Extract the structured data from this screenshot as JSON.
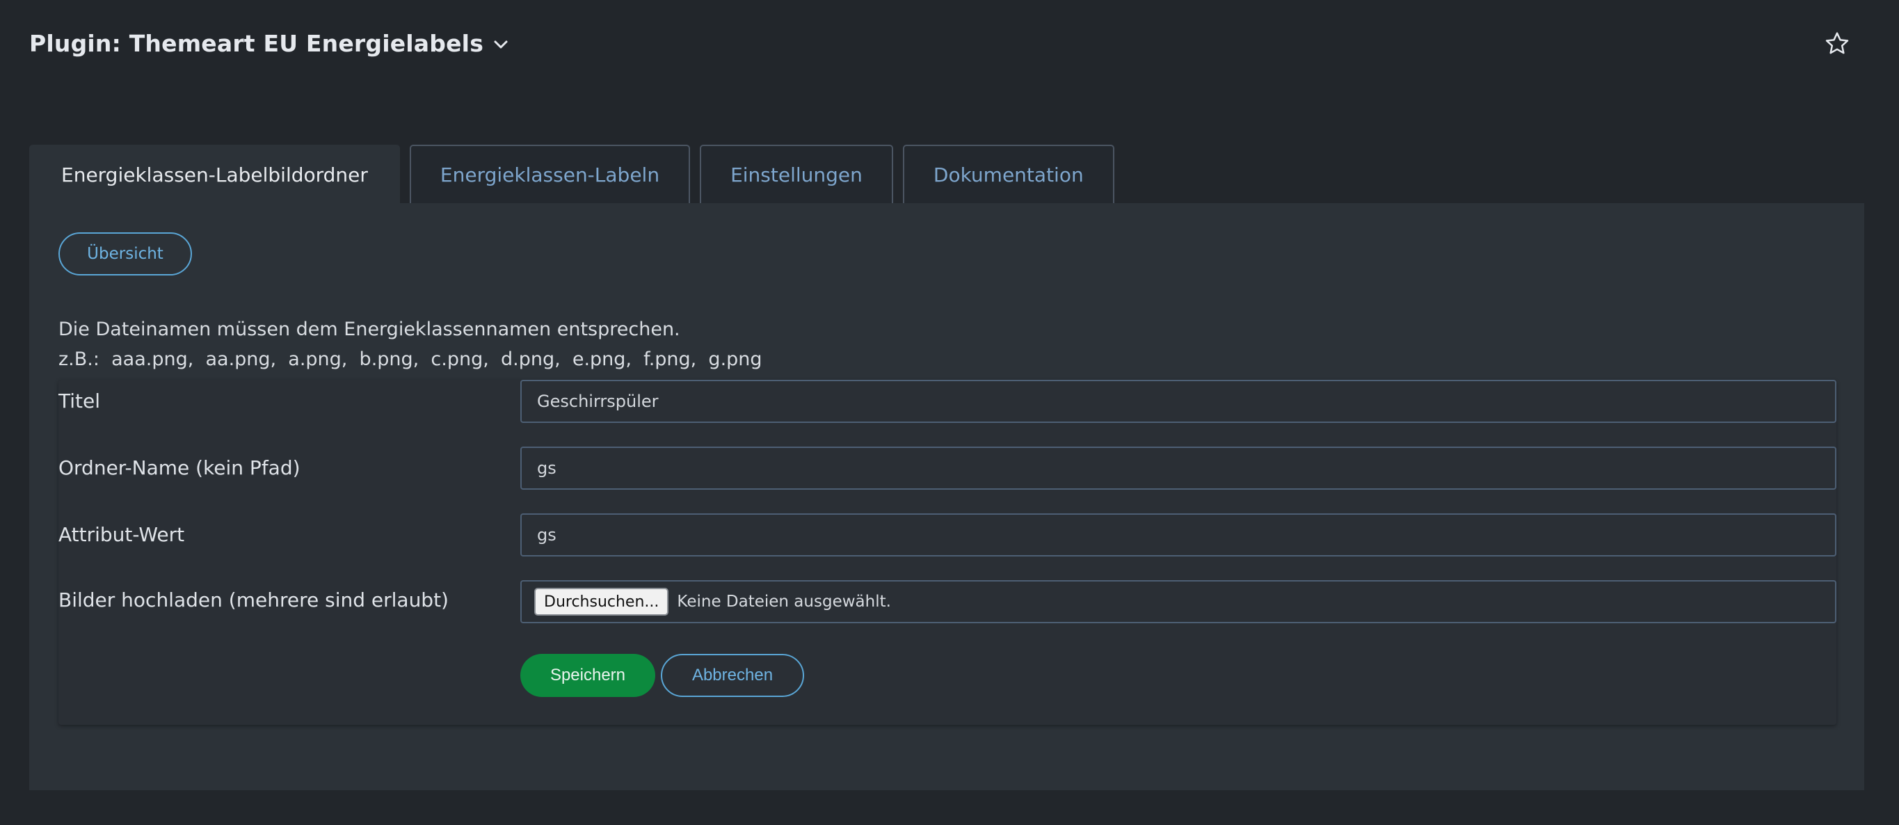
{
  "header": {
    "title": "Plugin: Themeart EU Energielabels",
    "icons": {
      "dropdown": "chevron-down-icon",
      "favorite": "star-icon"
    }
  },
  "tabs": [
    {
      "label": "Energieklassen-Labelbildordner",
      "active": true
    },
    {
      "label": "Energieklassen-Labeln",
      "active": false
    },
    {
      "label": "Einstellungen",
      "active": false
    },
    {
      "label": "Dokumentation",
      "active": false
    }
  ],
  "panel": {
    "overview_label": "Übersicht",
    "info_line1": "Die Dateinamen müssen dem Energieklassennamen entsprechen.",
    "info_line2": "z.B.:  aaa.png,  aa.png,  a.png,  b.png,  c.png,  d.png,  e.png,  f.png,  g.png"
  },
  "form": {
    "title_label": "Titel",
    "title_value": "Geschirrspüler",
    "folder_label": "Ordner-Name (kein Pfad)",
    "folder_value": "gs",
    "attribute_label": "Attribut-Wert",
    "attribute_value": "gs",
    "upload_label": "Bilder hochladen (mehrere sind erlaubt)",
    "browse_label": "Durchsuchen...",
    "file_status": "Keine Dateien ausgewählt.",
    "save_label": "Speichern",
    "cancel_label": "Abbrechen"
  },
  "colors": {
    "background": "#22262b",
    "panel": "#2c3238",
    "accent": "#5aa6d6",
    "save": "#0c8a3e"
  }
}
